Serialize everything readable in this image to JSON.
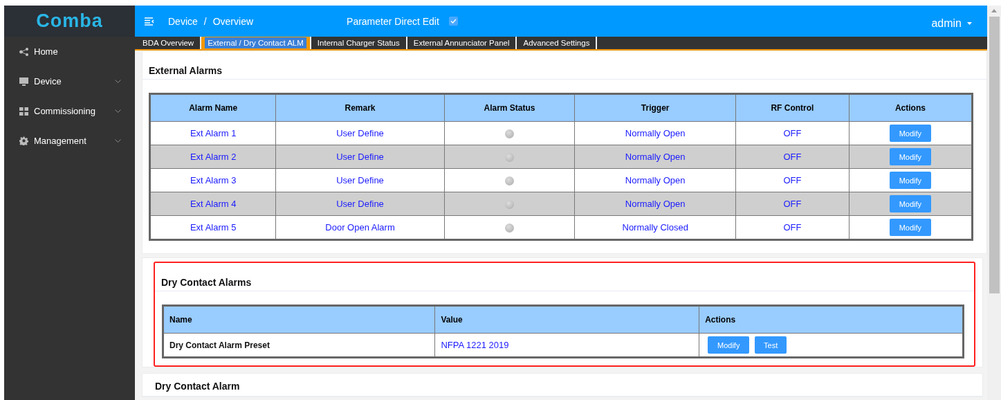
{
  "sidebar": {
    "logo": "Comba",
    "items": [
      {
        "label": "Home",
        "expandable": false
      },
      {
        "label": "Device",
        "expandable": true
      },
      {
        "label": "Commissioning",
        "expandable": true
      },
      {
        "label": "Management",
        "expandable": true
      }
    ]
  },
  "header": {
    "breadcrumb": {
      "items": [
        "Device",
        "Overview"
      ],
      "separator": "/"
    },
    "direct_edit": {
      "label": "Parameter Direct Edit",
      "checked": true
    },
    "user": "admin"
  },
  "tabs": [
    {
      "label": "BDA Overview",
      "selected": false
    },
    {
      "label": "External / Dry Contact ALM",
      "selected": true
    },
    {
      "label": "Internal Charger Status",
      "selected": false
    },
    {
      "label": "External Annunciator Panel",
      "selected": false
    },
    {
      "label": "Advanced Settings",
      "selected": false
    }
  ],
  "external_alarms": {
    "title": "External Alarms",
    "columns": [
      "Alarm Name",
      "Remark",
      "Alarm Status",
      "Trigger",
      "RF Control",
      "Actions"
    ],
    "rows": [
      {
        "name": "Ext Alarm 1",
        "remark": "User Define",
        "trigger": "Normally Open",
        "rf_control": "OFF",
        "action": "Modify"
      },
      {
        "name": "Ext Alarm 2",
        "remark": "User Define",
        "trigger": "Normally Open",
        "rf_control": "OFF",
        "action": "Modify"
      },
      {
        "name": "Ext Alarm 3",
        "remark": "User Define",
        "trigger": "Normally Open",
        "rf_control": "OFF",
        "action": "Modify"
      },
      {
        "name": "Ext Alarm 4",
        "remark": "User Define",
        "trigger": "Normally Open",
        "rf_control": "OFF",
        "action": "Modify"
      },
      {
        "name": "Ext Alarm 5",
        "remark": "Door Open Alarm",
        "trigger": "Normally Closed",
        "rf_control": "OFF",
        "action": "Modify"
      }
    ]
  },
  "dry_contact_alarms": {
    "title": "Dry Contact Alarms",
    "highlighted": true,
    "columns": [
      "Name",
      "Value",
      "Actions"
    ],
    "rows": [
      {
        "name": "Dry Contact Alarm Preset",
        "value": "NFPA 1221 2019",
        "actions": [
          "Modify",
          "Test"
        ]
      }
    ]
  },
  "dry_contact_alarm": {
    "title": "Dry Contact Alarm"
  }
}
